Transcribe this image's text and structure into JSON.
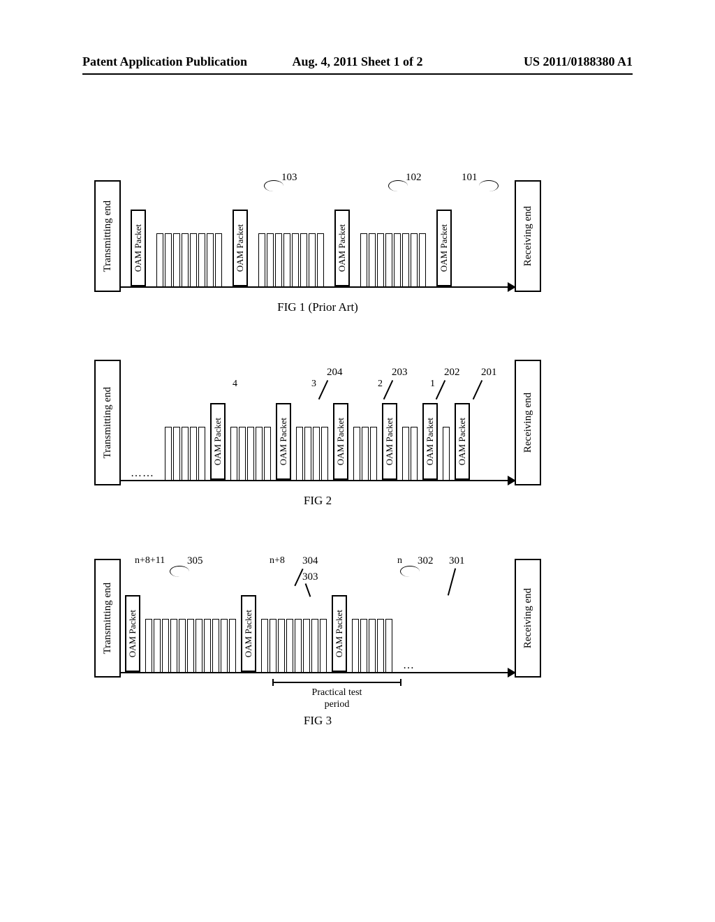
{
  "header": {
    "left": "Patent Application Publication",
    "center": "Aug. 4, 2011  Sheet 1 of 2",
    "right": "US 2011/0188380 A1"
  },
  "labels": {
    "transmitting": "Transmitting end",
    "receiving": "Receiving end",
    "oam": "OAM Packet"
  },
  "fig1": {
    "caption": "FIG 1 (Prior Art)",
    "refs": {
      "r101": "101",
      "r102": "102",
      "r103": "103"
    }
  },
  "fig2": {
    "caption": "FIG 2",
    "refs": {
      "r201": "201",
      "r202": "202",
      "r203": "203",
      "r204": "204"
    },
    "counts": {
      "c1": "1",
      "c2": "2",
      "c3": "3",
      "c4": "4"
    }
  },
  "fig3": {
    "caption": "FIG 3",
    "refs": {
      "r301": "301",
      "r302": "302",
      "r303": "303",
      "r304": "304",
      "r305": "305"
    },
    "seq": {
      "n": "n",
      "n8": "n+8",
      "n811": "n+8+11"
    },
    "period_label": "Practical test\nperiod"
  }
}
